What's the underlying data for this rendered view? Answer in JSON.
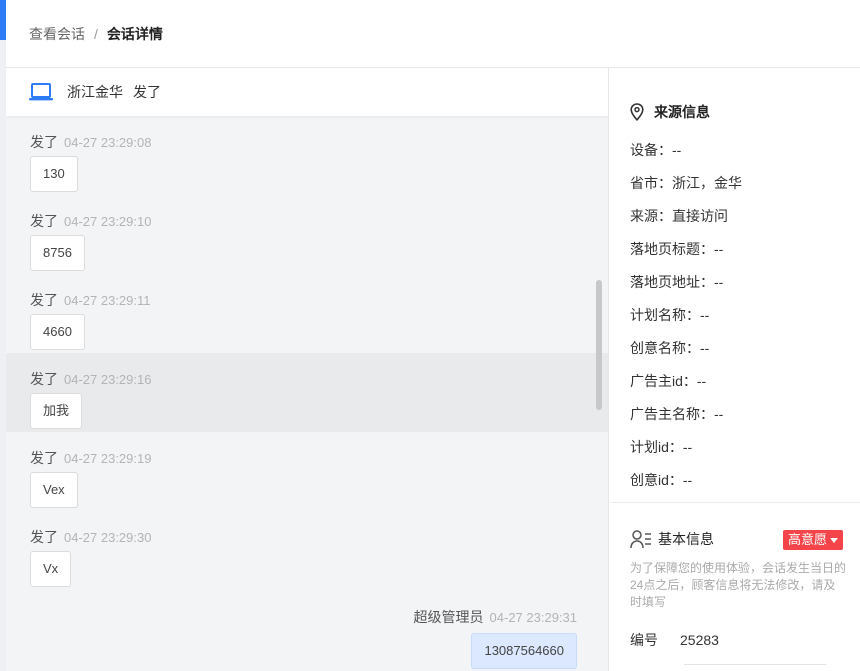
{
  "breadcrumb": {
    "parent": "查看会话",
    "separator": "/",
    "current": "会话详情"
  },
  "chat_header": {
    "location": "浙江金华",
    "visitor": "发了"
  },
  "messages": [
    {
      "sender": "发了",
      "time": "04-27 23:29:08",
      "text": "130",
      "highlight": false
    },
    {
      "sender": "发了",
      "time": "04-27 23:29:10",
      "text": "8756",
      "highlight": false
    },
    {
      "sender": "发了",
      "time": "04-27 23:29:11",
      "text": "4660",
      "highlight": false
    },
    {
      "sender": "发了",
      "time": "04-27 23:29:16",
      "text": "加我",
      "highlight": true
    },
    {
      "sender": "发了",
      "time": "04-27 23:29:19",
      "text": "Vex",
      "highlight": false
    },
    {
      "sender": "发了",
      "time": "04-27 23:29:30",
      "text": "Vx",
      "highlight": false
    }
  ],
  "reply": {
    "sender": "超级管理员",
    "time": "04-27 23:29:31",
    "text": "13087564660"
  },
  "source_info": {
    "title": "来源信息",
    "rows": [
      "设备：--",
      "省市：浙江，金华",
      "来源：直接访问",
      "落地页标题：--",
      "落地页地址：--",
      "计划名称：--",
      "创意名称：--",
      "广告主id：--",
      "广告主名称：--",
      "计划id：--",
      "创意id：--"
    ]
  },
  "basic_info": {
    "title": "基本信息",
    "intent_tag": "高意愿",
    "notice": "为了保障您的使用体验，会话发生当日的24点之后，顾客信息将无法修改，请及时填写",
    "number_label": "编号",
    "number_value": "25283"
  },
  "colors": {
    "accent_blue": "#2d7cf6",
    "tag_red": "#f5454a",
    "reply_bubble": "#dbe8ff"
  }
}
